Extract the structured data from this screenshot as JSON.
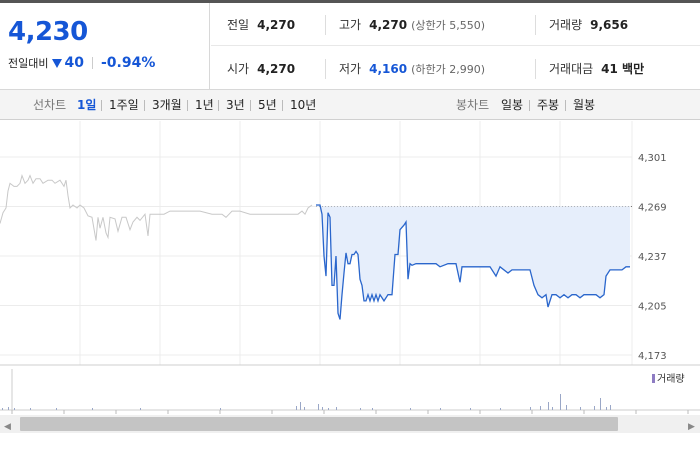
{
  "quote": {
    "price": "4,230",
    "change_label": "전일대비",
    "change_value": "40",
    "change_pct": "-0.94%",
    "colors": {
      "down": "#1556d6"
    },
    "row1": [
      {
        "key": "전일",
        "value": "4,270"
      },
      {
        "key": "고가",
        "value": "4,270",
        "note": "(상한가 5,550)"
      },
      {
        "key": "거래량",
        "value": "9,656"
      }
    ],
    "row2": [
      {
        "key": "시가",
        "value": "4,270"
      },
      {
        "key": "저가",
        "value": "4,160",
        "note": "(하한가 2,990)"
      },
      {
        "key": "거래대금",
        "value": "41 백만"
      }
    ]
  },
  "toolbar": {
    "line_label": "선차트",
    "line_items": [
      "1일",
      "1주일",
      "3개월",
      "1년",
      "3년",
      "5년",
      "10년"
    ],
    "active": "1일",
    "candle_label": "봉차트",
    "candle_items": [
      "일봉",
      "주봉",
      "월봉"
    ]
  },
  "chart_data": {
    "type": "line",
    "y_ticks": [
      "4,301",
      "4,269",
      "4,237",
      "4,205",
      "4,173"
    ],
    "ylim": [
      4173,
      4301
    ],
    "reference_price": 4269,
    "volume_legend": "거래량",
    "series": [
      {
        "style": "previous-day",
        "color": "#c8c8c8",
        "points": [
          [
            0,
            4258
          ],
          [
            3,
            4265
          ],
          [
            6,
            4268
          ],
          [
            8,
            4279
          ],
          [
            10,
            4284
          ],
          [
            14,
            4282
          ],
          [
            17,
            4282
          ],
          [
            20,
            4284
          ],
          [
            22,
            4289
          ],
          [
            25,
            4284
          ],
          [
            28,
            4286
          ],
          [
            30,
            4289
          ],
          [
            33,
            4284
          ],
          [
            36,
            4287
          ],
          [
            40,
            4287
          ],
          [
            43,
            4284
          ],
          [
            48,
            4286
          ],
          [
            52,
            4286
          ],
          [
            55,
            4284
          ],
          [
            60,
            4286
          ],
          [
            64,
            4282
          ],
          [
            66,
            4286
          ],
          [
            68,
            4276
          ],
          [
            70,
            4268
          ],
          [
            73,
            4270
          ],
          [
            77,
            4268
          ],
          [
            80,
            4270
          ],
          [
            84,
            4268
          ],
          [
            88,
            4263
          ],
          [
            92,
            4262
          ],
          [
            96,
            4247
          ],
          [
            98,
            4262
          ],
          [
            100,
            4255
          ],
          [
            103,
            4262
          ],
          [
            106,
            4252
          ],
          [
            108,
            4249
          ],
          [
            110,
            4262
          ],
          [
            115,
            4261
          ],
          [
            118,
            4253
          ],
          [
            122,
            4262
          ],
          [
            126,
            4262
          ],
          [
            130,
            4254
          ],
          [
            133,
            4259
          ],
          [
            137,
            4262
          ],
          [
            140,
            4260
          ],
          [
            145,
            4264
          ],
          [
            148,
            4250
          ],
          [
            150,
            4264
          ],
          [
            156,
            4264
          ],
          [
            164,
            4264
          ],
          [
            170,
            4266
          ],
          [
            180,
            4266
          ],
          [
            190,
            4266
          ],
          [
            200,
            4266
          ],
          [
            212,
            4264
          ],
          [
            222,
            4264
          ],
          [
            226,
            4262
          ],
          [
            232,
            4266
          ],
          [
            240,
            4266
          ],
          [
            250,
            4264
          ],
          [
            260,
            4264
          ],
          [
            270,
            4264
          ],
          [
            280,
            4264
          ],
          [
            290,
            4264
          ],
          [
            298,
            4264
          ],
          [
            302,
            4266
          ],
          [
            305,
            4264
          ],
          [
            308,
            4268
          ],
          [
            312,
            4270
          ]
        ]
      },
      {
        "style": "today",
        "color": "#2a66cc",
        "fill": "#e6eefb",
        "points": [
          [
            316,
            4270
          ],
          [
            320,
            4270
          ],
          [
            322,
            4264
          ],
          [
            324,
            4237
          ],
          [
            326,
            4224
          ],
          [
            328,
            4265
          ],
          [
            330,
            4262
          ],
          [
            332,
            4218
          ],
          [
            334,
            4218
          ],
          [
            336,
            4237
          ],
          [
            338,
            4200
          ],
          [
            340,
            4196
          ],
          [
            342,
            4212
          ],
          [
            344,
            4226
          ],
          [
            346,
            4239
          ],
          [
            348,
            4232
          ],
          [
            350,
            4232
          ],
          [
            352,
            4238
          ],
          [
            354,
            4238
          ],
          [
            356,
            4240
          ],
          [
            358,
            4238
          ],
          [
            360,
            4222
          ],
          [
            362,
            4218
          ],
          [
            364,
            4208
          ],
          [
            366,
            4208
          ],
          [
            368,
            4212
          ],
          [
            370,
            4208
          ],
          [
            372,
            4212
          ],
          [
            374,
            4208
          ],
          [
            376,
            4212
          ],
          [
            378,
            4208
          ],
          [
            380,
            4212
          ],
          [
            384,
            4208
          ],
          [
            388,
            4212
          ],
          [
            392,
            4212
          ],
          [
            395,
            4238
          ],
          [
            398,
            4238
          ],
          [
            400,
            4254
          ],
          [
            404,
            4257
          ],
          [
            406,
            4259
          ],
          [
            408,
            4222
          ],
          [
            410,
            4232
          ],
          [
            412,
            4231
          ],
          [
            416,
            4232
          ],
          [
            420,
            4232
          ],
          [
            428,
            4232
          ],
          [
            436,
            4232
          ],
          [
            440,
            4230
          ],
          [
            448,
            4232
          ],
          [
            456,
            4232
          ],
          [
            460,
            4220
          ],
          [
            462,
            4230
          ],
          [
            466,
            4230
          ],
          [
            470,
            4230
          ],
          [
            480,
            4230
          ],
          [
            490,
            4230
          ],
          [
            496,
            4224
          ],
          [
            500,
            4230
          ],
          [
            508,
            4226
          ],
          [
            512,
            4228
          ],
          [
            520,
            4228
          ],
          [
            530,
            4228
          ],
          [
            534,
            4218
          ],
          [
            538,
            4212
          ],
          [
            542,
            4210
          ],
          [
            546,
            4212
          ],
          [
            548,
            4204
          ],
          [
            552,
            4212
          ],
          [
            556,
            4212
          ],
          [
            560,
            4210
          ],
          [
            564,
            4212
          ],
          [
            568,
            4210
          ],
          [
            572,
            4212
          ],
          [
            576,
            4212
          ],
          [
            580,
            4210
          ],
          [
            584,
            4212
          ],
          [
            590,
            4212
          ],
          [
            596,
            4212
          ],
          [
            600,
            4210
          ],
          [
            604,
            4212
          ],
          [
            606,
            4224
          ],
          [
            610,
            4228
          ],
          [
            616,
            4228
          ],
          [
            622,
            4228
          ],
          [
            626,
            4230
          ],
          [
            630,
            4230
          ]
        ]
      }
    ],
    "volume": [
      [
        2,
        2
      ],
      [
        8,
        3
      ],
      [
        14,
        2
      ],
      [
        30,
        2
      ],
      [
        56,
        2
      ],
      [
        92,
        2
      ],
      [
        140,
        2
      ],
      [
        220,
        2
      ],
      [
        296,
        4
      ],
      [
        300,
        8
      ],
      [
        304,
        3
      ],
      [
        318,
        6
      ],
      [
        322,
        3
      ],
      [
        328,
        2
      ],
      [
        336,
        3
      ],
      [
        360,
        2
      ],
      [
        372,
        2
      ],
      [
        410,
        2
      ],
      [
        440,
        2
      ],
      [
        470,
        2
      ],
      [
        500,
        2
      ],
      [
        530,
        3
      ],
      [
        540,
        4
      ],
      [
        548,
        8
      ],
      [
        552,
        3
      ],
      [
        560,
        16
      ],
      [
        566,
        5
      ],
      [
        580,
        3
      ],
      [
        594,
        4
      ],
      [
        600,
        12
      ],
      [
        606,
        3
      ],
      [
        610,
        5
      ]
    ]
  },
  "scrollbar": {
    "left_arrow": "◀",
    "right_arrow": "▶"
  }
}
